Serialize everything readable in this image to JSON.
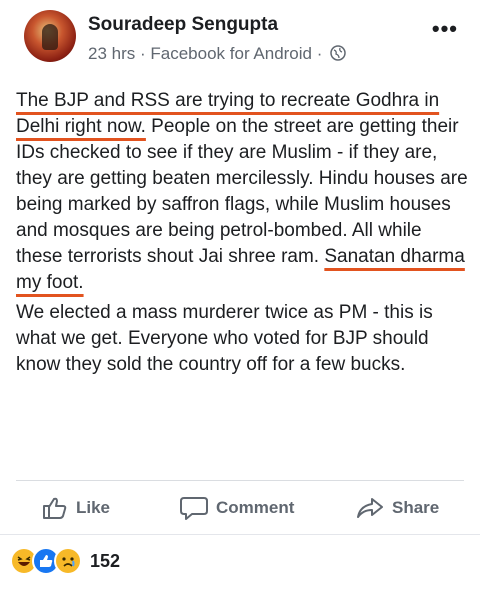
{
  "author": {
    "name": "Souradeep Sengupta",
    "time": "23 hrs",
    "source": "Facebook for Android",
    "separator": "·"
  },
  "post": {
    "p1_under1": "The BJP and RSS are trying to recreate Godhra in Delhi right now.",
    "p1_mid": " People on the street are getting their IDs checked to see if they are Muslim - if they are, they are getting beaten mercilessly. Hindu houses are being marked by saffron flags, while Muslim houses and mosques are being petrol-bombed. All while these terrorists shout Jai shree ram. ",
    "p1_under2": "Sanatan dharma my foot.",
    "p2": "We elected a mass murderer twice as PM - this is what we get. Everyone who voted for BJP should know they sold the country off for a few bucks."
  },
  "actions": {
    "like": "Like",
    "comment": "Comment",
    "share": "Share"
  },
  "reactions": {
    "count": "152",
    "types": [
      "haha",
      "like",
      "sad"
    ]
  },
  "colors": {
    "underline": "#e2531f",
    "like_blue": "#1877f2",
    "reaction_yellow": "#f7b928",
    "muted": "#606770"
  }
}
